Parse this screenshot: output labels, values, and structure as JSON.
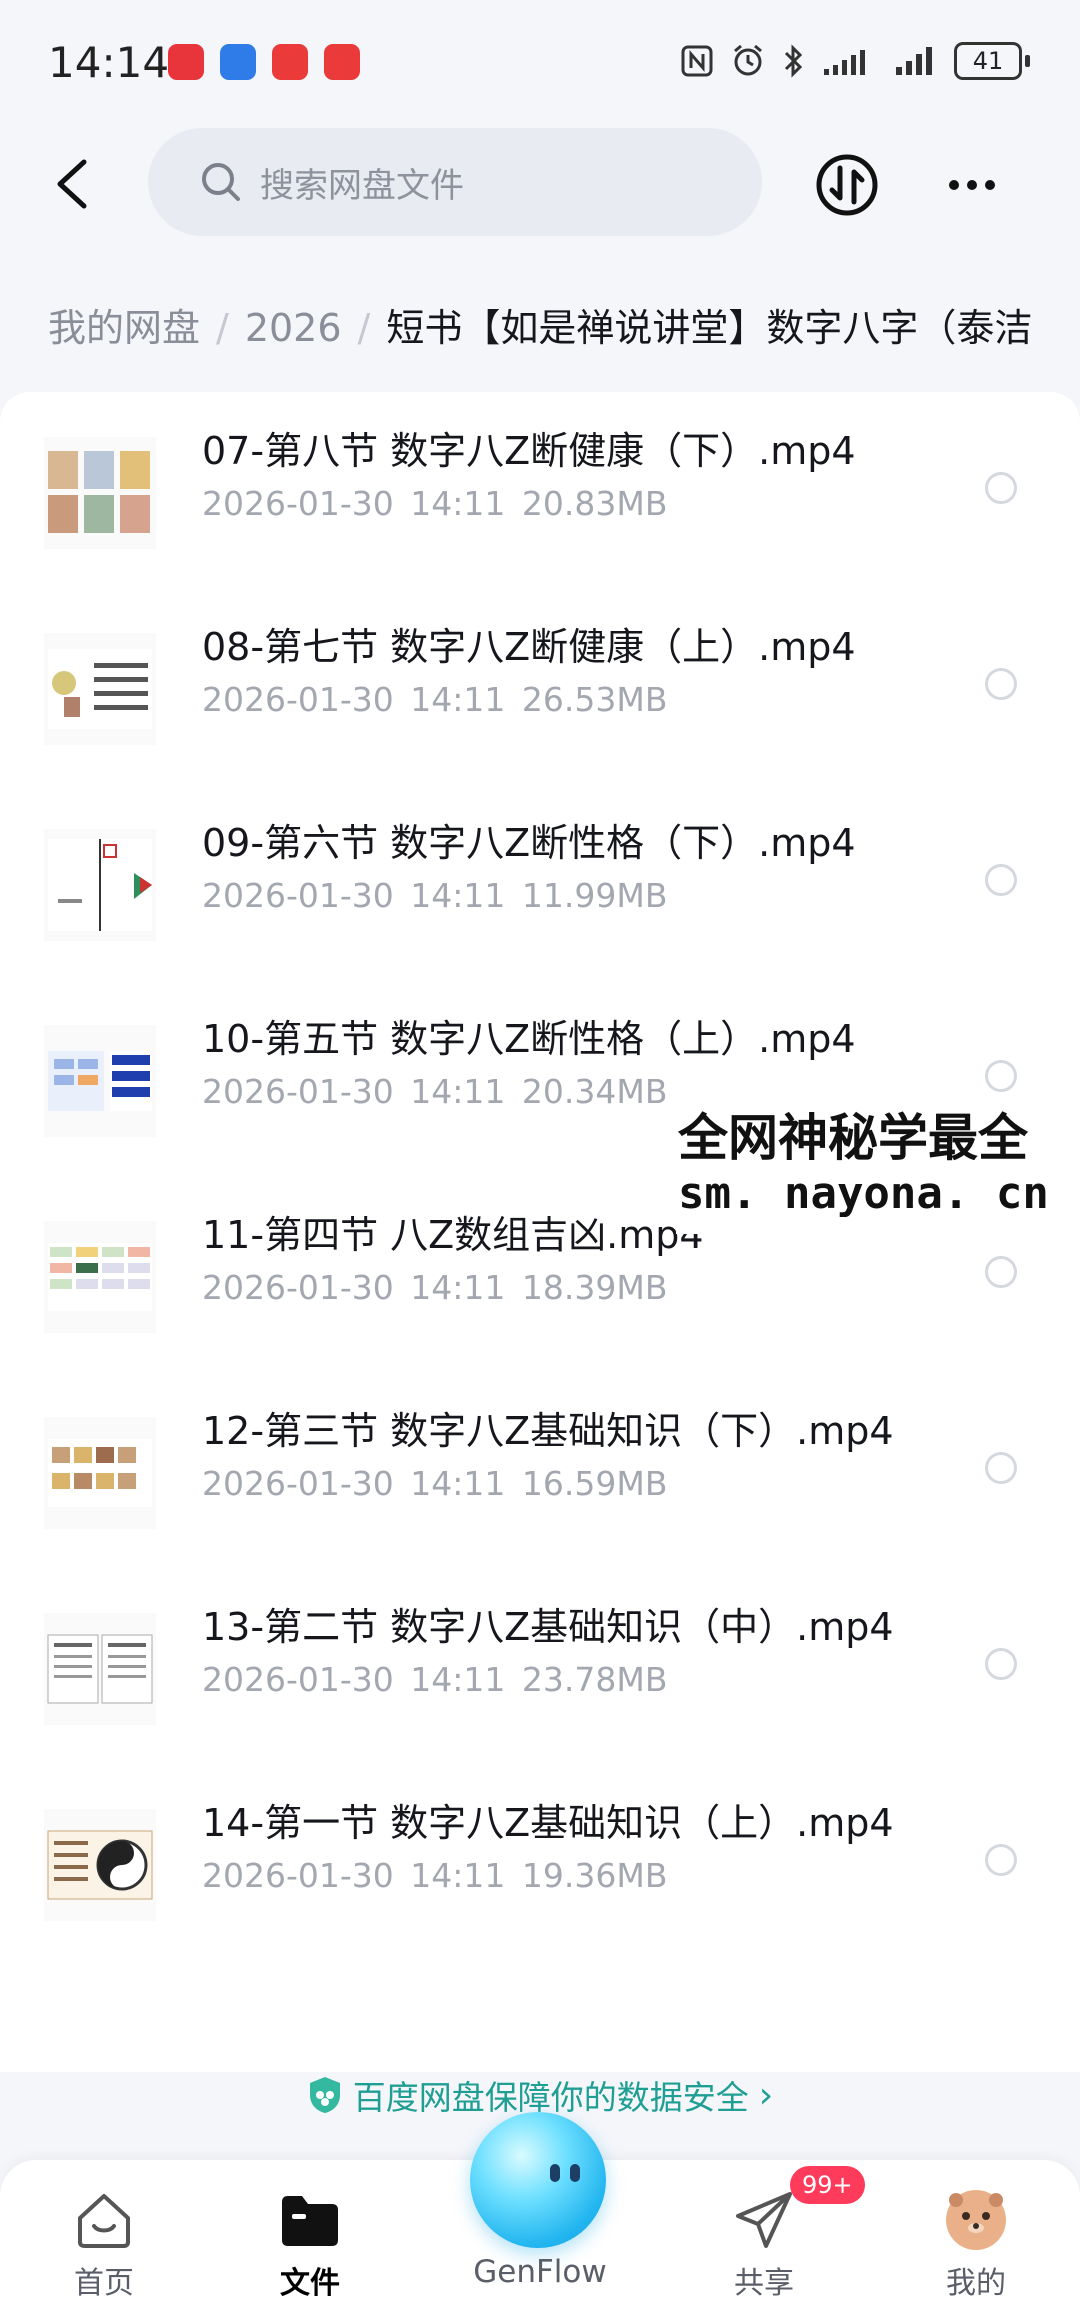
{
  "status_bar": {
    "time": "14:14",
    "battery": "41"
  },
  "search": {
    "placeholder": "搜索网盘文件"
  },
  "breadcrumb": {
    "root": "我的网盘",
    "separator": "/",
    "mid": "2026",
    "current": "短书【如是禅说讲堂】数字八字（泰洁"
  },
  "files": [
    {
      "name": "07-第八节 数字八Z断健康（下）.mp4",
      "date": "2026-01-30",
      "time": "14:11",
      "size": "20.83MB"
    },
    {
      "name": "08-第七节 数字八Z断健康（上）.mp4",
      "date": "2026-01-30",
      "time": "14:11",
      "size": "26.53MB"
    },
    {
      "name": "09-第六节 数字八Z断性格（下）.mp4",
      "date": "2026-01-30",
      "time": "14:11",
      "size": "11.99MB"
    },
    {
      "name": "10-第五节 数字八Z断性格（上）.mp4",
      "date": "2026-01-30",
      "time": "14:11",
      "size": "20.34MB"
    },
    {
      "name": "11-第四节 八Z数组吉凶.mp4",
      "date": "2026-01-30",
      "time": "14:11",
      "size": "18.39MB"
    },
    {
      "name": "12-第三节 数字八Z基础知识（下）.mp4",
      "date": "2026-01-30",
      "time": "14:11",
      "size": "16.59MB"
    },
    {
      "name": "13-第二节 数字八Z基础知识（中）.mp4",
      "date": "2026-01-30",
      "time": "14:11",
      "size": "23.78MB"
    },
    {
      "name": "14-第一节 数字八Z基础知识（上）.mp4",
      "date": "2026-01-30",
      "time": "14:11",
      "size": "19.36MB"
    }
  ],
  "watermark": {
    "line1": "全网神秘学最全",
    "line2": "sm. nayona. cn"
  },
  "security_banner": {
    "text": "百度网盘保障你的数据安全",
    "chevron": "›"
  },
  "bottom_nav": {
    "home": "首页",
    "files": "文件",
    "genflow": "GenFlow",
    "share": "共享",
    "share_badge": "99+",
    "me": "我的"
  },
  "colors": {
    "accent_teal": "#1f9e94",
    "badge_red": "#ff3b5c",
    "orb_blue": "#22b5ef"
  },
  "icons": {
    "back": "chevron-left-icon",
    "search": "search-icon",
    "transfer": "transfer-icon",
    "more": "more-dots-icon",
    "shield": "shield-icon",
    "home": "home-icon",
    "files": "folder-icon",
    "share": "paper-plane-icon",
    "me": "avatar-icon"
  }
}
